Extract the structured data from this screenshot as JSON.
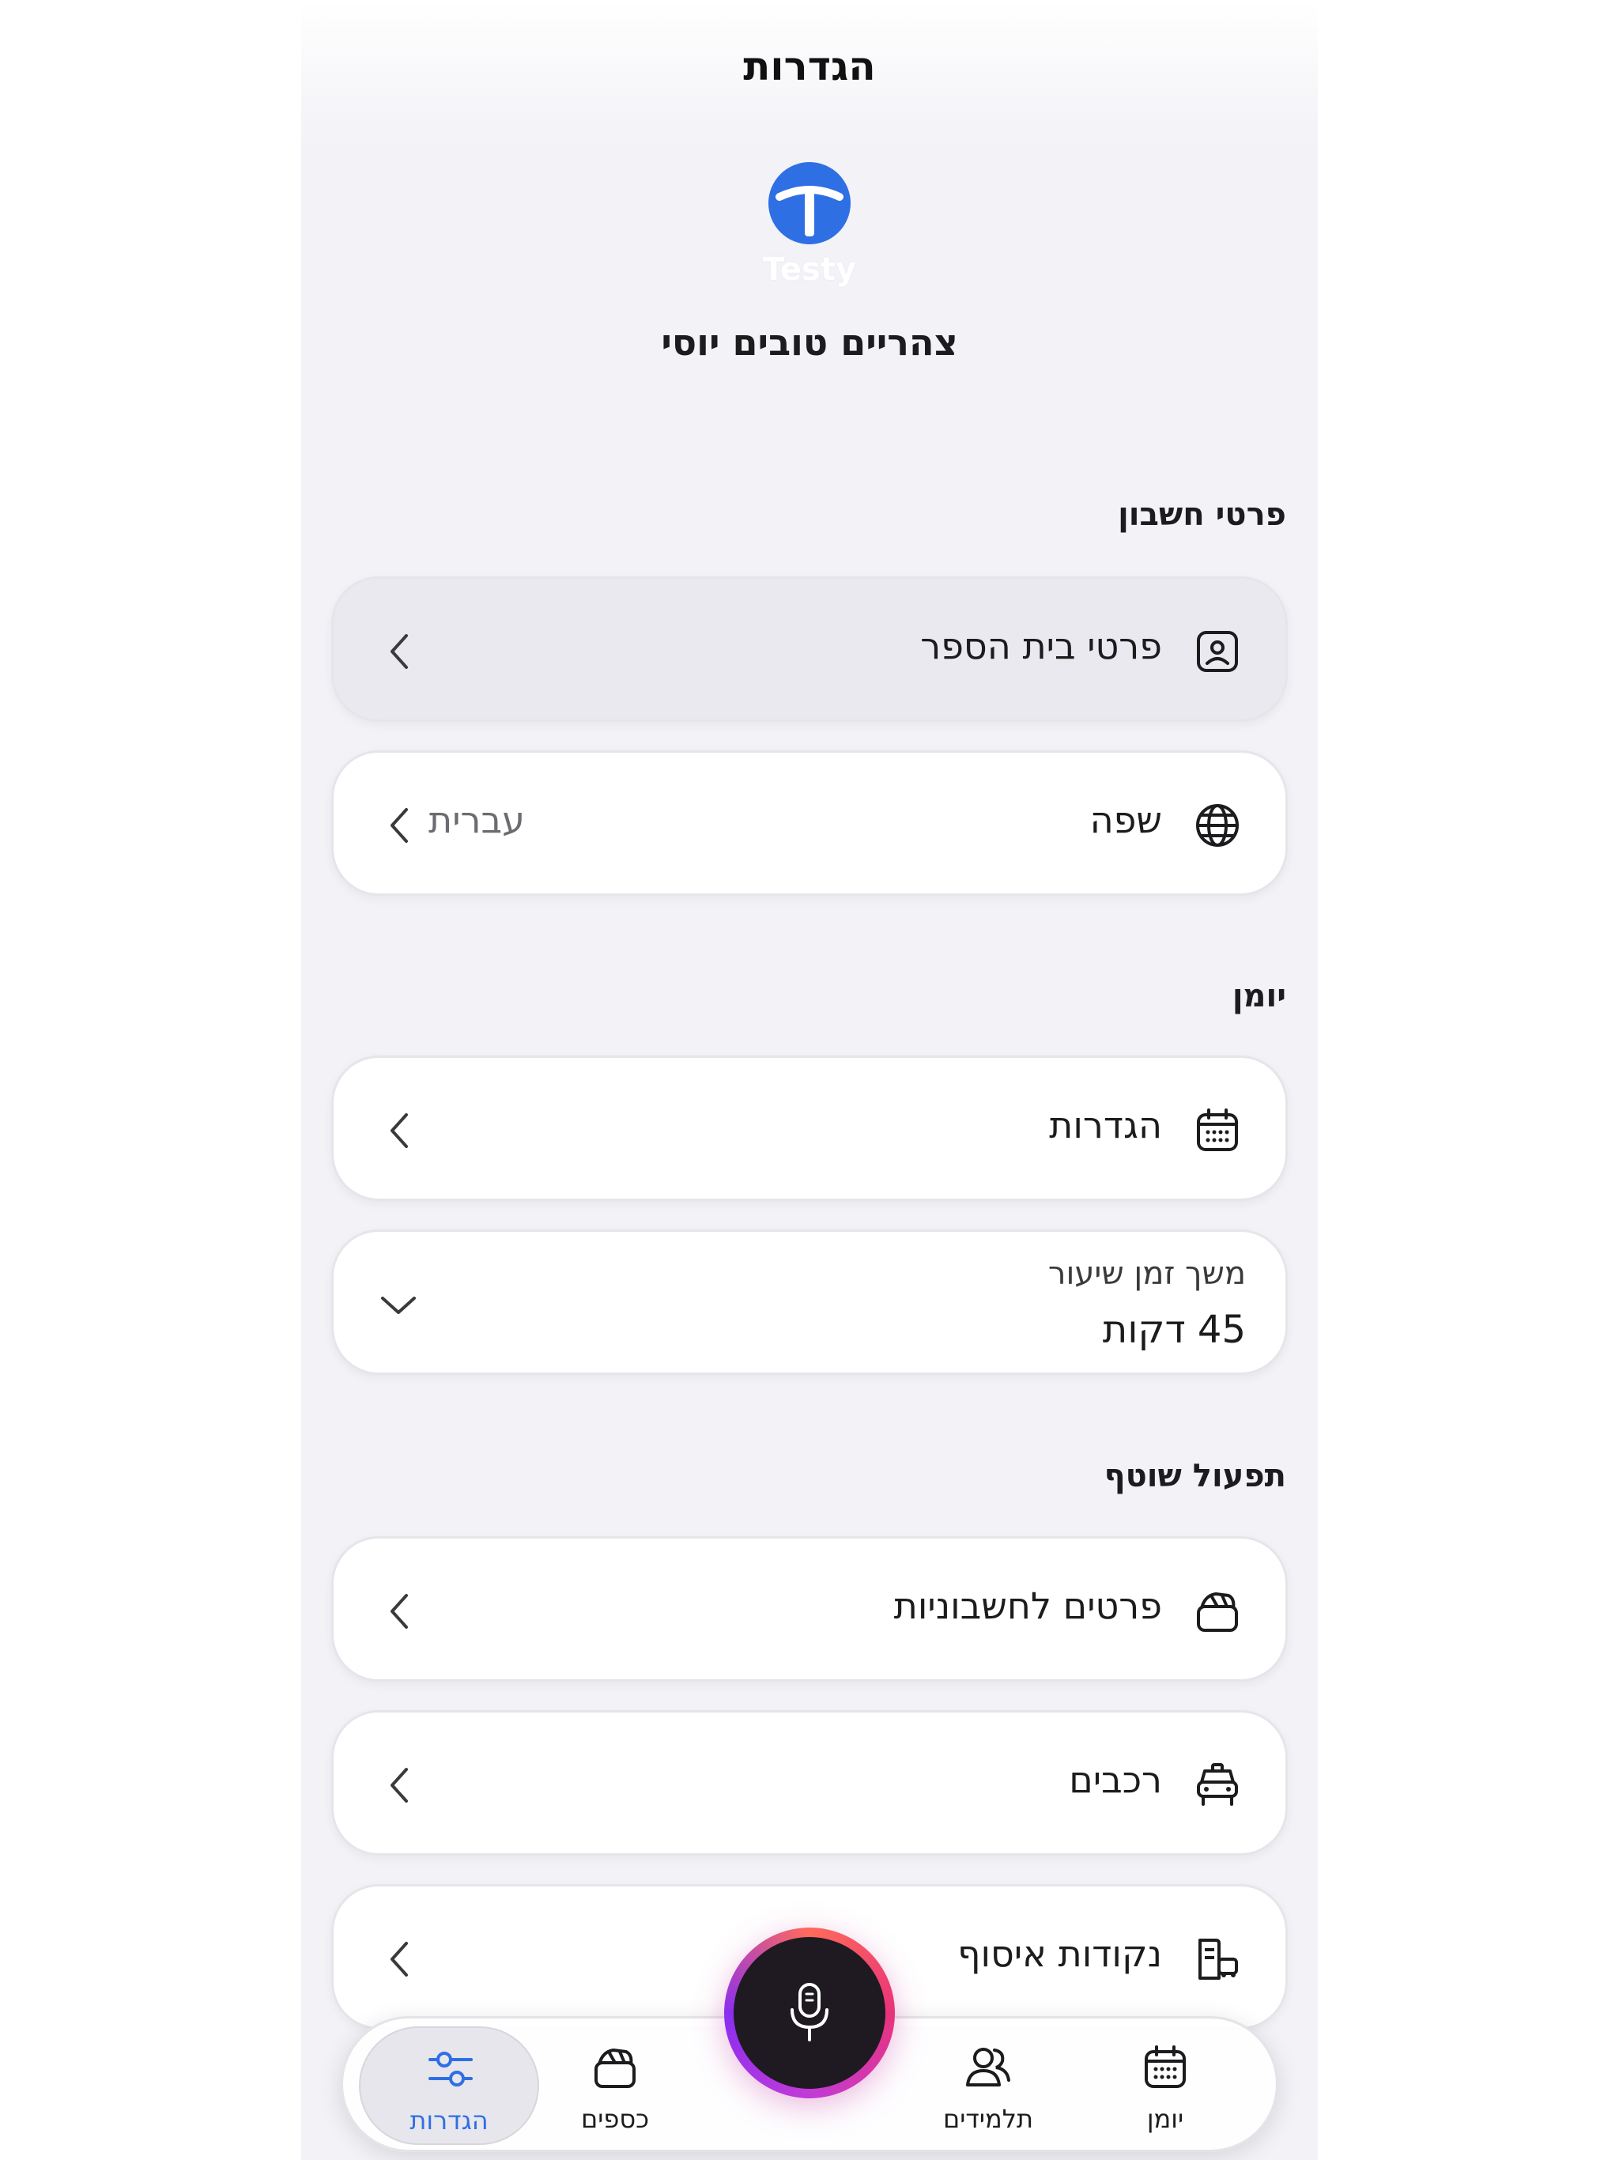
{
  "header": {
    "title": "הגדרות"
  },
  "brand": {
    "name": "Testy",
    "color": "#2f6fe4"
  },
  "greeting": "צהריים טובים יוסי",
  "sections": {
    "account": {
      "title": "פרטי חשבון",
      "items": [
        {
          "label": "פרטי בית הספר",
          "icon": "id-card-icon"
        },
        {
          "label": "שפה",
          "value": "עברית",
          "icon": "globe-icon"
        }
      ]
    },
    "diary": {
      "title": "יומן",
      "items": [
        {
          "label": "הגדרות",
          "icon": "calendar-icon"
        }
      ],
      "lesson_duration": {
        "label": "משך זמן שיעור",
        "value": "45 דקות"
      }
    },
    "shared": {
      "title": "תפעול שוטף",
      "items": [
        {
          "label": "פרטים לחשבוניות",
          "icon": "wallet-icon"
        },
        {
          "label": "רכבים",
          "icon": "car-icon"
        },
        {
          "label": "נקודות איסוף",
          "icon": "pickup-point-icon"
        }
      ]
    }
  },
  "tabbar": {
    "tabs": [
      {
        "label": "יומן",
        "icon": "calendar-icon"
      },
      {
        "label": "תלמידים",
        "icon": "users-icon"
      },
      {
        "label": "כספים",
        "icon": "wallet-icon"
      },
      {
        "label": "הגדרות",
        "icon": "sliders-icon",
        "active": true
      }
    ],
    "active_color": "#2f6fe4"
  },
  "mic": {
    "icon": "microphone-icon"
  }
}
